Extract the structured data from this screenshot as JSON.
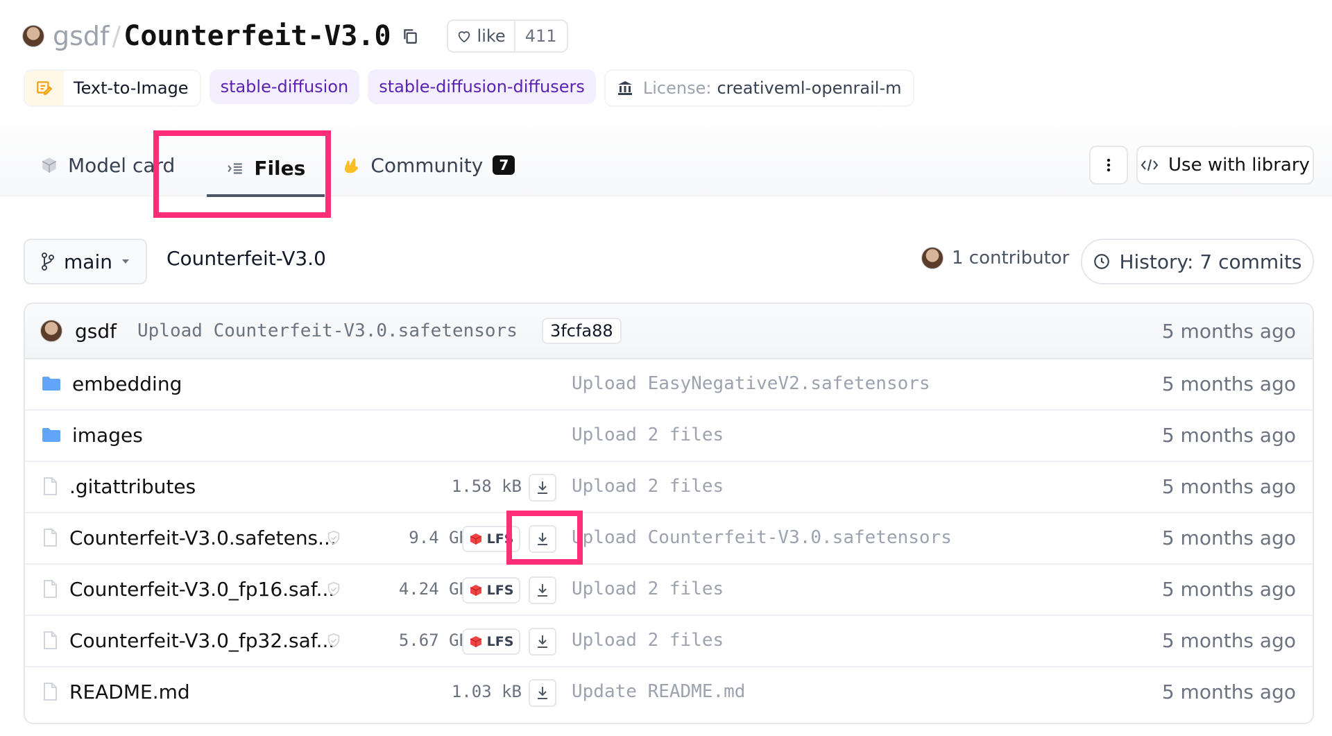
{
  "repo": {
    "owner": "gsdf",
    "separator": "/",
    "name": "Counterfeit-V3.0",
    "like_label": "like",
    "like_count": "411"
  },
  "tags": {
    "task": "Text-to-Image",
    "tag1": "stable-diffusion",
    "tag2": "stable-diffusion-diffusers",
    "license_key": "License:",
    "license_value": "creativeml-openrail-m"
  },
  "tabs": {
    "model_card": "Model card",
    "files": "Files",
    "community": "Community",
    "community_count": "7"
  },
  "actions": {
    "use_with_library": "Use with library"
  },
  "branch": {
    "name": "main",
    "path": "Counterfeit-V3.0",
    "contributors": "1 contributor",
    "history": "History: 7 commits"
  },
  "last_commit": {
    "author": "gsdf",
    "message": "Upload Counterfeit-V3.0.safetensors",
    "hash": "3fcfa88",
    "time": "5 months ago"
  },
  "files": [
    {
      "type": "folder",
      "name": "embedding",
      "size": "",
      "lfs": false,
      "download": false,
      "commit": "Upload EasyNegativeV2.safetensors",
      "time": "5 months ago"
    },
    {
      "type": "folder",
      "name": "images",
      "size": "",
      "lfs": false,
      "download": false,
      "commit": "Upload 2 files",
      "time": "5 months ago"
    },
    {
      "type": "file",
      "name": ".gitattributes",
      "size": "1.58 kB",
      "lfs": false,
      "download": true,
      "commit": "Upload 2 files",
      "time": "5 months ago"
    },
    {
      "type": "file",
      "name": "Counterfeit-V3.0.safetens...",
      "size": "9.4 GB",
      "lfs": true,
      "download": true,
      "commit": "Upload Counterfeit-V3.0.safetensors",
      "time": "5 months ago"
    },
    {
      "type": "file",
      "name": "Counterfeit-V3.0_fp16.saf...",
      "size": "4.24 GB",
      "lfs": true,
      "download": true,
      "commit": "Upload 2 files",
      "time": "5 months ago"
    },
    {
      "type": "file",
      "name": "Counterfeit-V3.0_fp32.saf...",
      "size": "5.67 GB",
      "lfs": true,
      "download": true,
      "commit": "Upload 2 files",
      "time": "5 months ago"
    },
    {
      "type": "file",
      "name": "README.md",
      "size": "1.03 kB",
      "lfs": false,
      "download": true,
      "commit": "Update README.md",
      "time": "5 months ago"
    }
  ],
  "lfs_label": "LFS",
  "colors": {
    "highlight": "#ff2d78",
    "tag_purple_bg": "#f3efff",
    "tag_purple_text": "#5b21b6",
    "folder_blue": "#60a5fa"
  },
  "icons": [
    "copy-icon",
    "heart-icon",
    "text-to-image-icon",
    "license-icon",
    "cube-icon",
    "files-icon",
    "community-icon",
    "kebab-icon",
    "code-icon",
    "branch-icon",
    "caret-down-icon",
    "clock-icon",
    "folder-icon",
    "file-icon",
    "download-icon",
    "lfs-icon",
    "security-check-icon"
  ]
}
